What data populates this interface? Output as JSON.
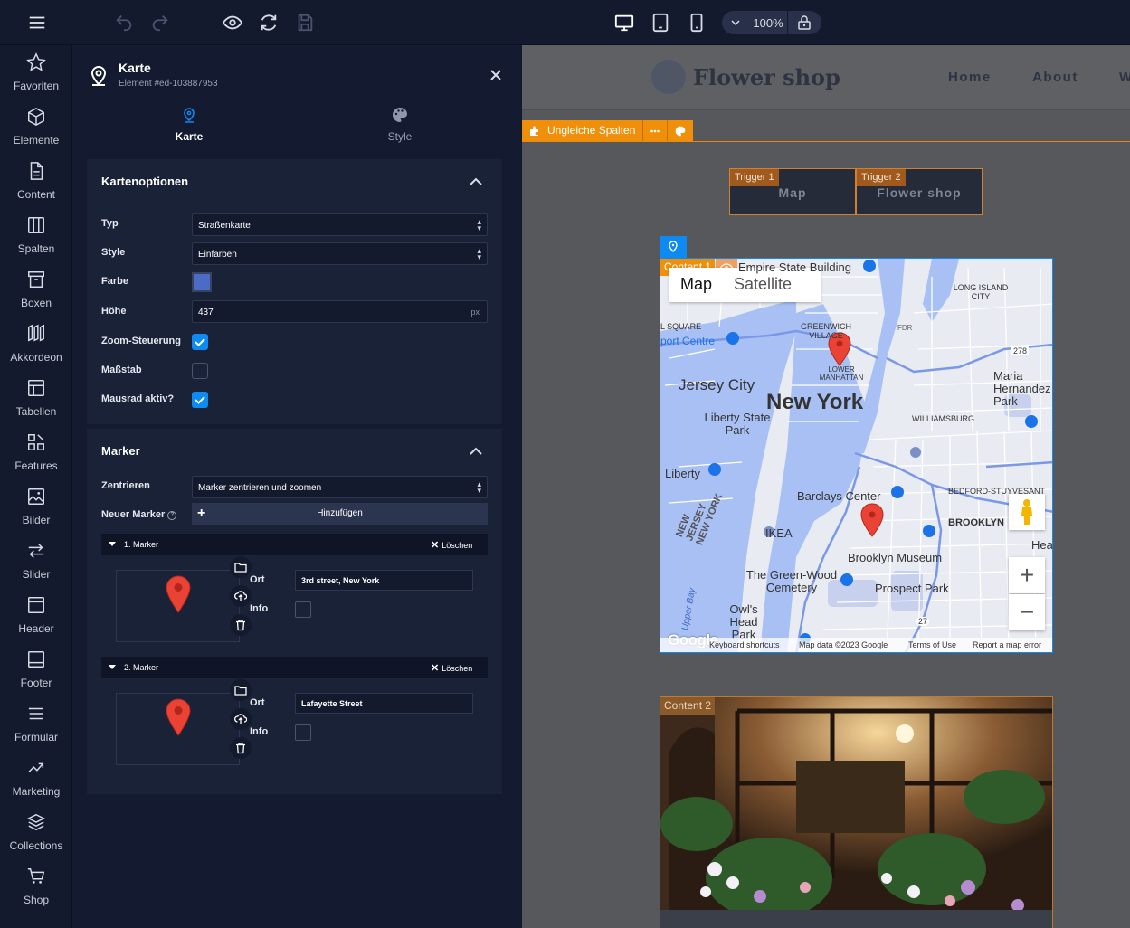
{
  "topbar": {
    "icons": [
      "menu-icon",
      "undo-icon",
      "redo-icon",
      "preview-eye-icon",
      "refresh-icon",
      "save-icon",
      "desktop-icon",
      "tablet-icon",
      "mobile-icon"
    ],
    "zoom_value": "100%"
  },
  "leftnav": {
    "items": [
      {
        "label": "Favoriten",
        "icon": "star-icon"
      },
      {
        "label": "Elemente",
        "icon": "cube-icon"
      },
      {
        "label": "Content",
        "icon": "document-icon"
      },
      {
        "label": "Spalten",
        "icon": "columns-icon"
      },
      {
        "label": "Boxen",
        "icon": "box-icon"
      },
      {
        "label": "Akkordeon",
        "icon": "accordion-icon"
      },
      {
        "label": "Tabellen",
        "icon": "table-icon"
      },
      {
        "label": "Features",
        "icon": "features-icon"
      },
      {
        "label": "Bilder",
        "icon": "image-icon"
      },
      {
        "label": "Slider",
        "icon": "slider-icon"
      },
      {
        "label": "Header",
        "icon": "header-icon"
      },
      {
        "label": "Footer",
        "icon": "footer-icon"
      },
      {
        "label": "Formular",
        "icon": "form-icon"
      },
      {
        "label": "Marketing",
        "icon": "trend-icon"
      },
      {
        "label": "Collections",
        "icon": "layers-icon"
      },
      {
        "label": "Shop",
        "icon": "cart-icon"
      }
    ]
  },
  "panel": {
    "title": "Karte",
    "subtitle": "Element #ed-103887953",
    "tabs": [
      {
        "label": "Karte"
      },
      {
        "label": "Style"
      }
    ],
    "kartenoptionen": {
      "title": "Kartenoptionen",
      "typ_label": "Typ",
      "typ_value": "Straßenkarte",
      "style_label": "Style",
      "style_value": "Einfärben",
      "farbe_label": "Farbe",
      "farbe_color": "#4a6cc6",
      "hoehe_label": "Höhe",
      "hoehe_value": "437",
      "hoehe_unit": "px",
      "zoom_label": "Zoom-Steuerung",
      "massstab_label": "Maßstab",
      "mausrad_label": "Mausrad aktiv?"
    },
    "marker": {
      "title": "Marker",
      "zentrieren_label": "Zentrieren",
      "zentrieren_value": "Marker zentrieren und zoomen",
      "neuer_label": "Neuer Marker",
      "add_label": "Hinzufügen",
      "ort_label": "Ort",
      "info_label": "Info",
      "delete_label": "Löschen",
      "items": [
        {
          "title": "1. Marker",
          "ort": "3rd street, New York"
        },
        {
          "title": "2. Marker",
          "ort": "Lafayette Street"
        }
      ]
    }
  },
  "canvas": {
    "logo_text": "Flower shop",
    "nav": [
      "Home",
      "About",
      "W"
    ],
    "section_tag": "Ungleiche Spalten",
    "triggers": [
      {
        "tag": "Trigger 1",
        "text": "Map"
      },
      {
        "tag": "Trigger 2",
        "text": "Flower shop"
      }
    ],
    "content1_tag": "Content 1",
    "content2_tag": "Content 2",
    "map": {
      "tab_map": "Map",
      "tab_satellite": "Satellite",
      "labels": {
        "empire": "Empire State Building",
        "long_island": "LONG ISLAND CITY",
        "greenwich": "GREENWICH VILLAGE",
        "ford": "FDR",
        "square": "L SQUARE",
        "port_centre": "port Centre",
        "lower_manhattan": "LOWER MANHATTAN",
        "jersey_city": "Jersey City",
        "new_york": "New York",
        "maria": "Maria Hernandez Park",
        "liberty_park": "Liberty State Park",
        "williamsburg": "WILLIAMSBURG",
        "liberty": "Liberty",
        "barclays": "Barclays Center",
        "bedford": "BEDFORD-STUYVESANT",
        "new_jersey": "NEW JERSEY NEW YORK",
        "brooklyn": "BROOKLYN",
        "ikea": "IKEA",
        "brooklyn_museum": "Brooklyn Museum",
        "green_wood": "The Green-Wood Cemetery",
        "prospect": "Prospect Park",
        "owls_head": "Owl's Head Park",
        "upper_bay": "Upper Bay",
        "hea": "Hea",
        "route278": "278",
        "route27": "27",
        "google": "Google"
      },
      "footer": {
        "shortcuts": "Keyboard shortcuts",
        "data": "Map data ©2023 Google",
        "terms": "Terms of Use",
        "report": "Report a map error"
      }
    }
  }
}
